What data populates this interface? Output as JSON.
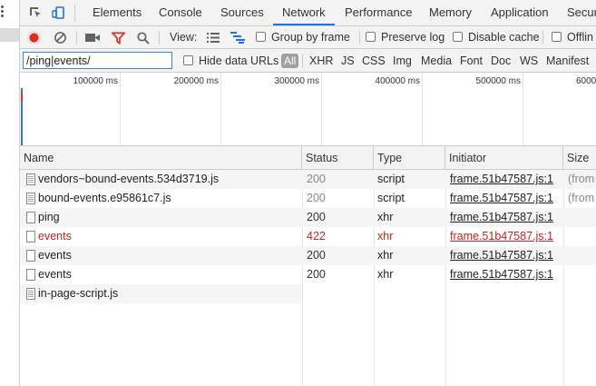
{
  "tabs": [
    {
      "label": "Elements"
    },
    {
      "label": "Console"
    },
    {
      "label": "Sources"
    },
    {
      "label": "Network",
      "active": true
    },
    {
      "label": "Performance"
    },
    {
      "label": "Memory"
    },
    {
      "label": "Application"
    },
    {
      "label": "Secur"
    }
  ],
  "toolbar": {
    "view_label": "View:",
    "group_by_frame": "Group by frame",
    "preserve_log": "Preserve log",
    "disable_cache": "Disable cache",
    "offline": "Offlin"
  },
  "filter": {
    "value": "/ping|events/",
    "hide_data_urls": "Hide data URLs",
    "types": [
      "All",
      "XHR",
      "JS",
      "CSS",
      "Img",
      "Media",
      "Font",
      "Doc",
      "WS",
      "Manifest"
    ]
  },
  "overview": {
    "ticks": [
      "100000 ms",
      "200000 ms",
      "300000 ms",
      "400000 ms",
      "500000 ms",
      "6000"
    ]
  },
  "table": {
    "columns": [
      "Name",
      "Status",
      "Type",
      "Initiator",
      "Size"
    ],
    "rows": [
      {
        "name": "vendors~bound-events.534d3719.js",
        "status": "200",
        "type": "script",
        "initiator": "frame.51b47587.js:1",
        "size": "(from"
      },
      {
        "name": "bound-events.e95861c7.js",
        "status": "200",
        "type": "script",
        "initiator": "frame.51b47587.js:1",
        "size": "(from"
      },
      {
        "name": "ping",
        "status": "200",
        "type": "xhr",
        "initiator": "frame.51b47587.js:1",
        "size": ""
      },
      {
        "name": "events",
        "status": "422",
        "type": "xhr",
        "initiator": "frame.51b47587.js:1",
        "size": ""
      },
      {
        "name": "events",
        "status": "200",
        "type": "xhr",
        "initiator": "frame.51b47587.js:1",
        "size": ""
      },
      {
        "name": "events",
        "status": "200",
        "type": "xhr",
        "initiator": "frame.51b47587.js:1",
        "size": ""
      },
      {
        "name": "in-page-script.js",
        "status": "",
        "type": "",
        "initiator": "",
        "size": ""
      }
    ]
  },
  "colors": {
    "accent": "#1a73e8",
    "error": "#c5221f",
    "record": "#d93025"
  }
}
